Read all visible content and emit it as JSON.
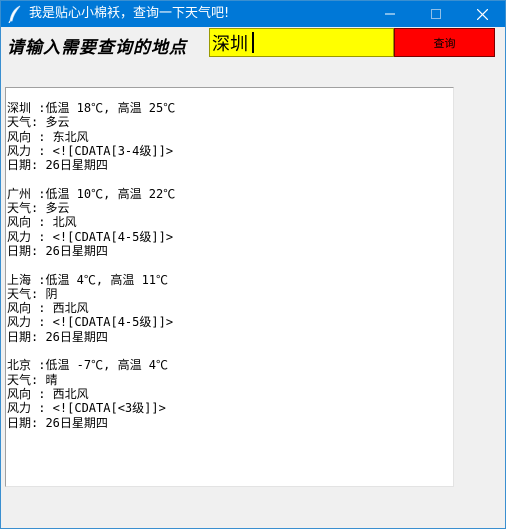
{
  "window": {
    "title": "我是贴心小棉袄，查询一下天气吧!",
    "icon": "feather-icon",
    "controls": [
      "minimize-icon",
      "maximize-icon",
      "close-icon"
    ],
    "titlebar_color": "#0078d7"
  },
  "form": {
    "prompt": "请输入需要查询的地点",
    "city_value": "深圳",
    "input_background": "#ffff00",
    "query_label": "查询",
    "query_background": "#ff0000"
  },
  "output": {
    "text": "深圳 :低温 18℃, 高温 25℃\n天气: 多云\n风向 : 东北风\n风力 : <![CDATA[3-4级]]>\n日期: 26日星期四\n\n广州 :低温 10℃, 高温 22℃\n天气: 多云\n风向 : 北风\n风力 : <![CDATA[4-5级]]>\n日期: 26日星期四\n\n上海 :低温 4℃, 高温 11℃\n天气: 阴\n风向 : 西北风\n风力 : <![CDATA[4-5级]]>\n日期: 26日星期四\n\n北京 :低温 -7℃, 高温 4℃\n天气: 晴\n风向 : 西北风\n风力 : <![CDATA[<3级]]>\n日期: 26日星期四"
  }
}
